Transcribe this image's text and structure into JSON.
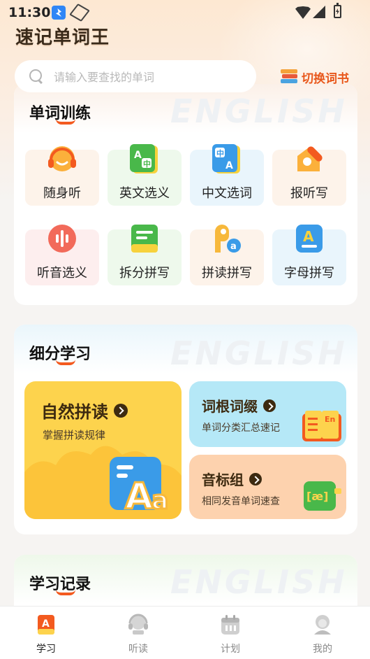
{
  "status_bar": {
    "time": "11:30"
  },
  "app": {
    "title": "速记单词王"
  },
  "search": {
    "placeholder": "请输入要查找的单词"
  },
  "switch_book": {
    "label": "切换词书",
    "icon": "books-icon"
  },
  "word_training": {
    "title": "单词训练",
    "watermark": "ENGLISH",
    "items": [
      {
        "label": "随身听",
        "icon": "headphones-icon",
        "bg": "#fdf3ea"
      },
      {
        "label": "英文选义",
        "icon": "english-translate-icon",
        "bg": "#eef9ec"
      },
      {
        "label": "中文选词",
        "icon": "chinese-translate-icon",
        "bg": "#e9f5fc"
      },
      {
        "label": "报听写",
        "icon": "dictation-icon",
        "bg": "#fdf3ea"
      },
      {
        "label": "听音选义",
        "icon": "sound-wave-icon",
        "bg": "#fdeeee"
      },
      {
        "label": "拆分拼写",
        "icon": "split-spelling-icon",
        "bg": "#eef9ec"
      },
      {
        "label": "拼读拼写",
        "icon": "phonics-spelling-icon",
        "bg": "#fdf3ea"
      },
      {
        "label": "字母拼写",
        "icon": "letter-spelling-icon",
        "bg": "#e9f5fc"
      }
    ]
  },
  "detailed_study": {
    "title": "细分学习",
    "watermark": "ENGLISH",
    "natural_phonics": {
      "title": "自然拼读",
      "subtitle": "掌握拼读规律",
      "color": "#fdd34d"
    },
    "roots_affixes": {
      "title": "词根词缀",
      "subtitle": "单词分类汇总速记",
      "color": "#b5e8f7"
    },
    "phonetic_group": {
      "title": "音标组",
      "subtitle": "相同发音单词速查",
      "color": "#fdd2ae",
      "icon_text": "[æ]"
    },
    "book_icon_text": "En"
  },
  "study_record": {
    "title": "学习记录",
    "watermark": "ENGLISH"
  },
  "tabbar": {
    "items": [
      {
        "label": "学习",
        "icon": "study-book-icon",
        "active": true
      },
      {
        "label": "听读",
        "icon": "listen-read-icon",
        "active": false
      },
      {
        "label": "计划",
        "icon": "plan-icon",
        "active": false
      },
      {
        "label": "我的",
        "icon": "profile-icon",
        "active": false
      }
    ]
  },
  "colors": {
    "accent": "#f35a1f",
    "switch_text": "#e8571b"
  }
}
